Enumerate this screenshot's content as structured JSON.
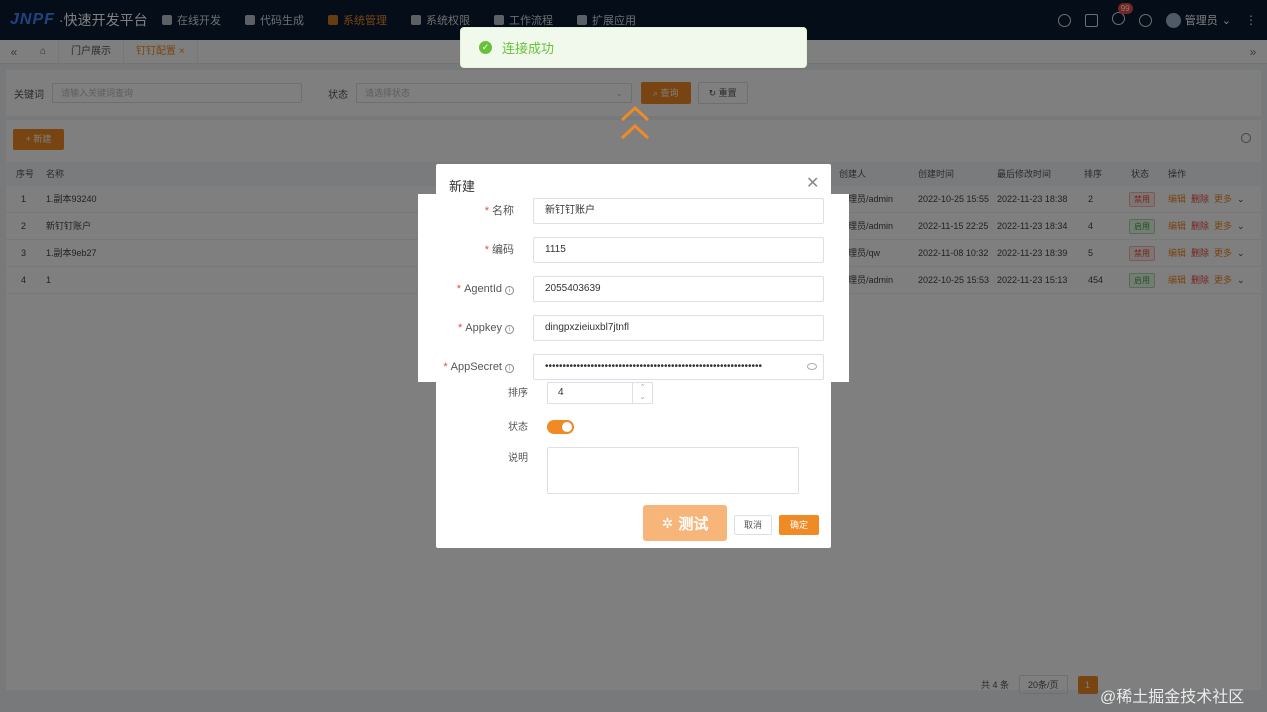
{
  "topbar": {
    "logo_mark": "JNPF",
    "logo_text": "·快速开发平台",
    "nav": [
      "在线开发",
      "代码生成",
      "系统管理",
      "系统权限",
      "工作流程",
      "扩展应用"
    ],
    "active_nav": "系统管理",
    "badge": "99",
    "user": "管理员"
  },
  "tabs": [
    "门户展示",
    "钉钉配置"
  ],
  "search": {
    "keyword_label": "关键词",
    "keyword_placeholder": "请输入关键词查询",
    "status_label": "状态",
    "status_placeholder": "请选择状态",
    "query": "查询",
    "reset": "重置"
  },
  "table": {
    "new_button": "新建",
    "headers": {
      "index": "序号",
      "name": "名称",
      "creator": "创建人",
      "created": "创建时间",
      "modified": "最后修改时间",
      "sort": "排序",
      "status": "状态",
      "ops": "操作"
    },
    "rows": [
      {
        "index": "1",
        "name": "1.副本93240",
        "creator": "管理员/admin",
        "created": "2022-10-25 15:55",
        "modified": "2022-11-23 18:38",
        "sort": "2",
        "status": "禁用",
        "on": false
      },
      {
        "index": "2",
        "name": "新钉钉账户",
        "creator": "管理员/admin",
        "created": "2022-11-15 22:25",
        "modified": "2022-11-23 18:34",
        "sort": "4",
        "status": "启用",
        "on": true
      },
      {
        "index": "3",
        "name": "1.副本9eb27",
        "creator": "管理员/qw",
        "created": "2022-11-08 10:32",
        "modified": "2022-11-23 18:39",
        "sort": "5",
        "status": "禁用",
        "on": false
      },
      {
        "index": "4",
        "name": "1",
        "creator": "管理员/admin",
        "created": "2022-10-25 15:53",
        "modified": "2022-11-23 15:13",
        "sort": "454",
        "status": "启用",
        "on": true
      }
    ],
    "ops": {
      "edit": "编辑",
      "delete": "删除",
      "more": "更多"
    },
    "pager": {
      "total": "共 4 条",
      "page_size": "20条/页",
      "page": "1"
    }
  },
  "toast": {
    "message": "连接成功"
  },
  "dialog": {
    "title": "新建",
    "fields": [
      {
        "label": "名称",
        "value": "新钉钉账户",
        "required": true,
        "info": false
      },
      {
        "label": "编码",
        "value": "1115",
        "required": true,
        "info": false
      },
      {
        "label": "AgentId",
        "value": "2055403639",
        "required": true,
        "info": true
      },
      {
        "label": "Appkey",
        "value": "dingpxzieiuxbl7jtnfl",
        "required": true,
        "info": true
      },
      {
        "label": "AppSecret",
        "value": "••••••••••••••••••••••••••••••••••••••••••••••••••••••••••••••",
        "required": true,
        "info": true
      }
    ],
    "sort_label": "排序",
    "sort_value": "4",
    "status_label": "状态",
    "status_on": true,
    "desc_label": "说明",
    "test_button": "测试",
    "cancel_button": "取消",
    "ok_button": "确定"
  },
  "colors": {
    "accent": "#f08a24",
    "nav_bg": "#0b1b30",
    "success": "#67c23a",
    "danger": "#e84a3f"
  },
  "watermark": "@稀土掘金技术社区"
}
